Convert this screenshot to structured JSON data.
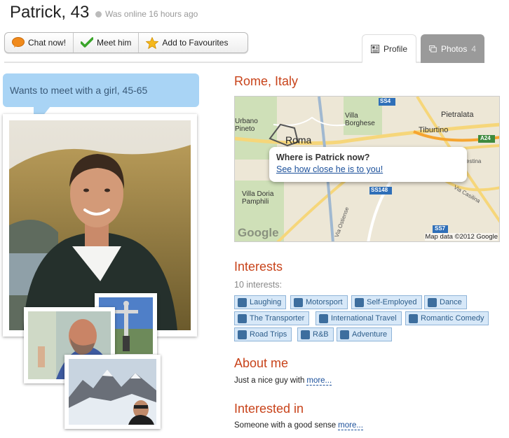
{
  "header": {
    "name": "Patrick, 43",
    "online_status": "Was online 16 hours ago"
  },
  "actions": {
    "chat_label": "Chat now!",
    "meet_label": "Meet him",
    "favourite_label": "Add to Favourites"
  },
  "tabs": {
    "profile_label": "Profile",
    "photos_label": "Photos",
    "photos_count": "4"
  },
  "left": {
    "wants_text": "Wants to meet with a girl, 45-65"
  },
  "location": {
    "heading": "Rome, Italy",
    "popup_question": "Where is Patrick now?",
    "popup_link": "See how close he is to you!",
    "attribution": "Map data ©2012 Google",
    "logo": "Google",
    "labels": {
      "roma": "Roma",
      "villa_borghese": "Villa Borghese",
      "tiburtino": "Tiburtino",
      "pietralata": "Pietralata",
      "urbano": "Urbano Pineto",
      "villa_doria": "Villa Doria Pamphili",
      "via_ostiense": "Via Ostiense",
      "via_casilina": "Via Casilina",
      "prenestina": "estina",
      "ss4": "SS4",
      "a24": "A24",
      "ss148": "SS148",
      "ss7": "SS7"
    }
  },
  "interests": {
    "heading": "Interests",
    "count_text": "10 interests:",
    "items": [
      {
        "label": "Laughing",
        "icon": "laugh-icon"
      },
      {
        "label": "Motorsport",
        "icon": "trophy-icon"
      },
      {
        "label": "Self-Employed",
        "icon": "briefcase-icon"
      },
      {
        "label": "Dance",
        "icon": "music-note-icon"
      },
      {
        "label": "The Transporter",
        "icon": "film-icon"
      },
      {
        "label": "International Travel",
        "icon": "globe-icon"
      },
      {
        "label": "Romantic Comedy",
        "icon": "tv-icon"
      },
      {
        "label": "Road Trips",
        "icon": "globe-icon"
      },
      {
        "label": "R&B",
        "icon": "music-note-icon"
      },
      {
        "label": "Adventure",
        "icon": "adventure-icon"
      }
    ]
  },
  "about": {
    "heading": "About me",
    "text": "Just a nice guy with",
    "more": "more..."
  },
  "interested_in": {
    "heading": "Interested in",
    "text": "Someone with a good sense",
    "more": "more..."
  },
  "colors": {
    "accent_heading": "#c8431a",
    "bubble": "#a9d4f5",
    "tag_bg": "#d7e8f8",
    "link": "#1a4f9a"
  }
}
